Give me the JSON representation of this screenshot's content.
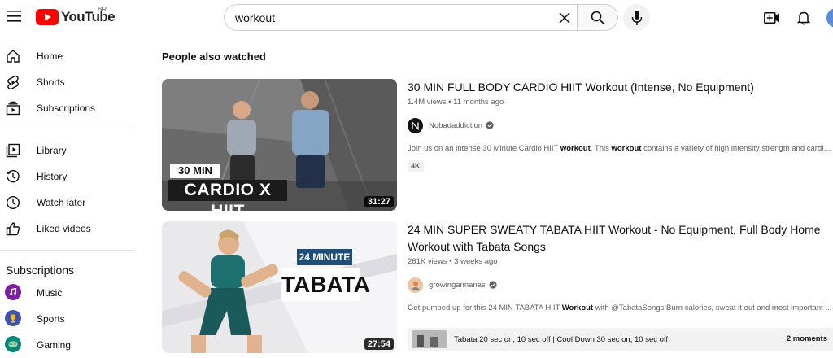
{
  "header": {
    "logo_text": "YouTube",
    "region_code": "BR",
    "search_value": "workout"
  },
  "sidebar": {
    "items": [
      {
        "label": "Home",
        "icon": "home-icon"
      },
      {
        "label": "Shorts",
        "icon": "shorts-icon"
      },
      {
        "label": "Subscriptions",
        "icon": "subscriptions-icon"
      },
      {
        "label": "Library",
        "icon": "library-icon"
      },
      {
        "label": "History",
        "icon": "history-icon"
      },
      {
        "label": "Watch later",
        "icon": "clock-icon"
      },
      {
        "label": "Liked videos",
        "icon": "thumbs-up-icon"
      }
    ],
    "subscriptions_heading": "Subscriptions",
    "subscriptions": [
      {
        "label": "Music",
        "color": "#7b1fa2"
      },
      {
        "label": "Sports",
        "color": "#3f51b5"
      },
      {
        "label": "Gaming",
        "color": "#00897b"
      }
    ]
  },
  "main": {
    "section_title": "People also watched",
    "results": [
      {
        "title": "30 MIN FULL BODY CARDIO HIIT Workout (Intense, No Equipment)",
        "views": "1.4M views",
        "age": "11 months ago",
        "channel": "Nobadaddiction",
        "description_pre": "Join us on an intense 30 Minute Cardio HIIT ",
        "description_bold": "workout",
        "description_mid": ". This ",
        "description_bold2": "workout",
        "description_post": " contains a variety of high intensity strength and cardio ...",
        "badge": "4K",
        "duration": "31:27",
        "thumb_line1": "30 MIN",
        "thumb_line2": "CARDIO X HIIT"
      },
      {
        "title": "24 MIN SUPER SWEATY TABATA HIIT Workout - No Equipment, Full Body Home Workout with Tabata Songs",
        "views": "261K views",
        "age": "3 weeks ago",
        "channel": "growingannanas",
        "description_pre": "Get pumped up for this 24 MIN TABATA HIIT ",
        "description_bold": "Workout",
        "description_post": " with @TabataSongs Burn calories, sweat it out and most important ...",
        "chapter_text": "Tabata 20 sec on, 10 sec off | Cool Down 30 sec on, 10 sec off",
        "chapter_count": "2 moments",
        "duration": "27:54",
        "thumb_line1": "24 MINUTE",
        "thumb_line2": "TABATA"
      }
    ]
  }
}
